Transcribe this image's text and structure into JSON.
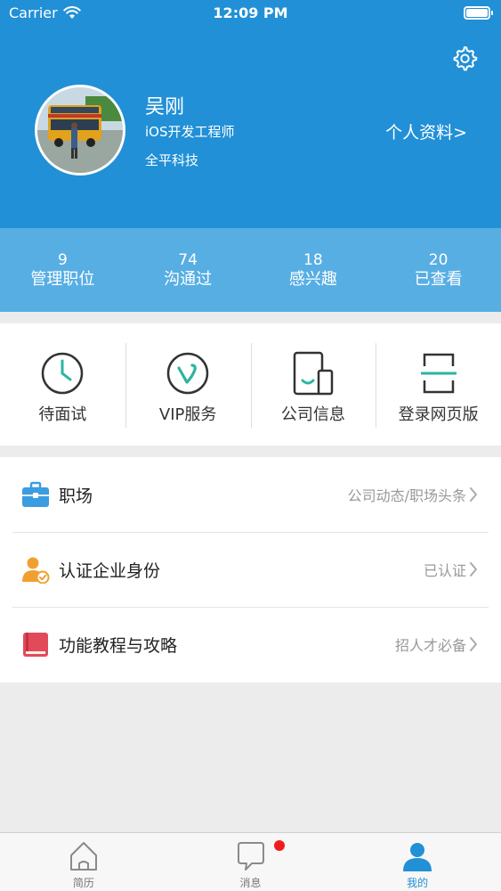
{
  "status_bar": {
    "carrier": "Carrier",
    "time": "12:09 PM"
  },
  "profile": {
    "name": "吴刚",
    "role": "iOS开发工程师",
    "company": "全平科技",
    "link_label": "个人资料>"
  },
  "stats": [
    {
      "value": "9",
      "label": "管理职位"
    },
    {
      "value": "74",
      "label": "沟通过"
    },
    {
      "value": "18",
      "label": "感兴趣"
    },
    {
      "value": "20",
      "label": "已查看"
    }
  ],
  "quick_actions": [
    {
      "label": "待面试",
      "icon": "clock-icon"
    },
    {
      "label": "VIP服务",
      "icon": "vip-icon"
    },
    {
      "label": "公司信息",
      "icon": "company-icon"
    },
    {
      "label": "登录网页版",
      "icon": "scan-icon"
    }
  ],
  "menu": [
    {
      "title": "职场",
      "value": "公司动态/职场头条",
      "icon": "briefcase-icon"
    },
    {
      "title": "认证企业身份",
      "value": "已认证",
      "icon": "verified-user-icon"
    },
    {
      "title": "功能教程与攻略",
      "value": "招人才必备",
      "icon": "book-icon"
    }
  ],
  "tabs": [
    {
      "label": "简历",
      "icon": "home-icon",
      "active": false
    },
    {
      "label": "消息",
      "icon": "chat-icon",
      "active": false
    },
    {
      "label": "我的",
      "icon": "person-icon",
      "active": true
    }
  ],
  "colors": {
    "primary": "#2190d6",
    "stats_bg": "#57aee3",
    "accent_teal": "#2bb5a0",
    "badge": "#f21b1b"
  }
}
